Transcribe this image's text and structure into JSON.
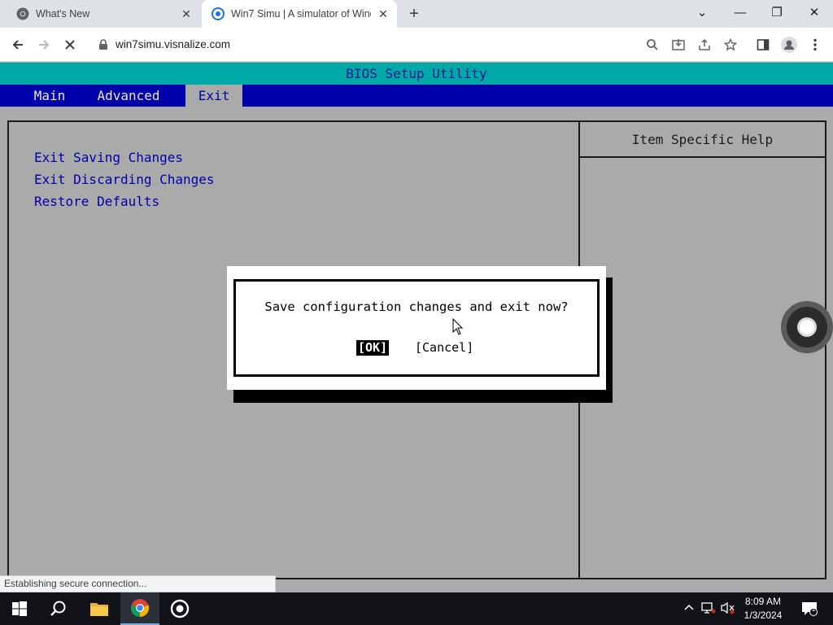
{
  "browser": {
    "tabs": [
      {
        "title": "What's New",
        "icon": "chrome-icon",
        "active": false
      },
      {
        "title": "Win7 Simu | A simulator of Windows 7",
        "icon": "win7simu-icon",
        "active": true
      }
    ],
    "close_glyph": "✕",
    "new_tab_glyph": "+",
    "window_controls": {
      "tab_search": "⌄",
      "minimize": "—",
      "restore": "❐",
      "close": "✕"
    },
    "url": "win7simu.visnalize.com",
    "status_text": "Establishing secure connection..."
  },
  "bios": {
    "title": "BIOS Setup Utility",
    "menu": [
      {
        "label": "Main",
        "selected": false
      },
      {
        "label": "Advanced",
        "selected": false
      },
      {
        "label": "Exit",
        "selected": true
      }
    ],
    "options": [
      "Exit Saving Changes",
      "Exit Discarding Changes",
      "Restore Defaults"
    ],
    "help_title": "Item Specific Help",
    "colors": {
      "title_bar": "#00a8a8",
      "menu_bar": "#0000aa",
      "background": "#aaaaaa",
      "option_text": "#0000aa"
    }
  },
  "dialog": {
    "message": "Save configuration changes and exit now?",
    "ok_label": "[OK]",
    "cancel_label": "[Cancel]"
  },
  "taskbar": {
    "time": "8:09 AM",
    "date": "1/3/2024",
    "notification_count": "1",
    "pinned": [
      "start-icon",
      "search-icon",
      "file-explorer-icon",
      "chrome-icon",
      "win7simu-icon"
    ]
  }
}
